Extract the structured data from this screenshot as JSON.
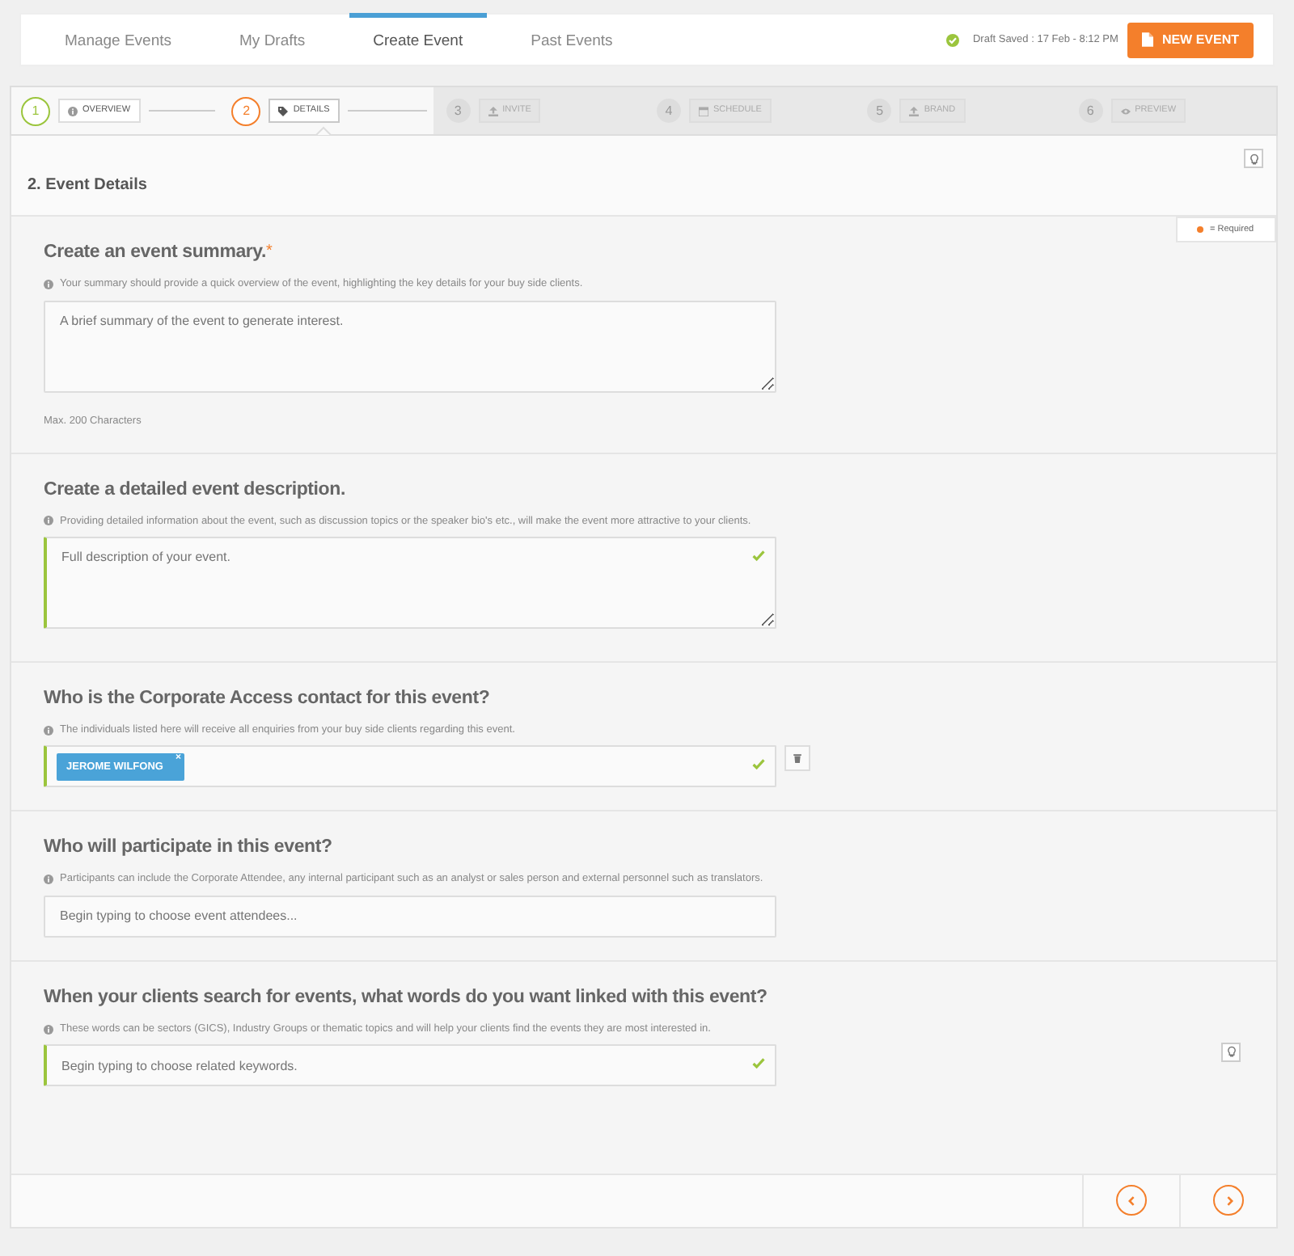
{
  "nav": {
    "tabs": [
      {
        "label": "Manage Events",
        "selected": false
      },
      {
        "label": "My Drafts",
        "selected": false
      },
      {
        "label": "Create Event",
        "selected": true
      },
      {
        "label": "Past Events",
        "selected": false
      }
    ],
    "status": "Draft Saved : 17 Feb - 8:12 PM",
    "new_button": "NEW EVENT"
  },
  "steps": [
    {
      "number": "1",
      "label": "OVERVIEW",
      "completed": true,
      "selected": false
    },
    {
      "number": "2",
      "label": "DETAILS",
      "completed": false,
      "selected": true
    },
    {
      "number": "3",
      "label": "INVITE",
      "completed": false,
      "selected": false
    },
    {
      "number": "4",
      "label": "SCHEDULE",
      "completed": false,
      "selected": false
    },
    {
      "number": "5",
      "label": "BRAND",
      "completed": false,
      "selected": false
    },
    {
      "number": "6",
      "label": "PREVIEW",
      "completed": false,
      "selected": false
    }
  ],
  "panel": {
    "title": "2. Event Details",
    "legend": "= Required"
  },
  "sections": [
    {
      "heading": "Create an event summary.",
      "required_mark": "*",
      "hint": "Your summary should provide a quick overview of the event, highlighting the key details for your buy side clients.",
      "field": {
        "kind": "textarea",
        "placeholder": "A brief summary of the event to generate interest.",
        "valid": false
      },
      "note": "Max. 200 Characters",
      "delete": false,
      "tip": false
    },
    {
      "heading": "Create a detailed event description.",
      "hint": "Providing detailed information about the event, such as discussion topics or the speaker bio's etc., will make the event more attractive to your clients.",
      "field": {
        "kind": "textarea",
        "placeholder": "Full description of your event.",
        "valid": true
      },
      "delete": false,
      "tip": false
    },
    {
      "heading": "Who is the Corporate Access contact for this event?",
      "hint": "The individuals listed here will receive all enquiries from your buy side clients regarding this event.",
      "field": {
        "kind": "tags",
        "tags": [
          {
            "name": "JEROME WILFONG",
            "remove": "×"
          }
        ],
        "valid": true
      },
      "delete": true,
      "tip": false
    },
    {
      "heading": "Who will participate in this event?",
      "hint": "Participants can include the Corporate Attendee, any internal participant such as an analyst or sales person and external personnel such as translators.",
      "field": {
        "kind": "input",
        "placeholder": "Begin typing to choose event attendees...",
        "valid": false
      },
      "delete": false,
      "tip": false
    },
    {
      "heading": "When your clients search for events, what words do you want linked with this event?",
      "hint": "These words can be sectors (GICS), Industry Groups or thematic topics and will help your clients find the events they are most interested in.",
      "field": {
        "kind": "input",
        "placeholder": "Begin typing to choose related keywords.",
        "valid": true
      },
      "delete": false,
      "tip": true
    }
  ]
}
